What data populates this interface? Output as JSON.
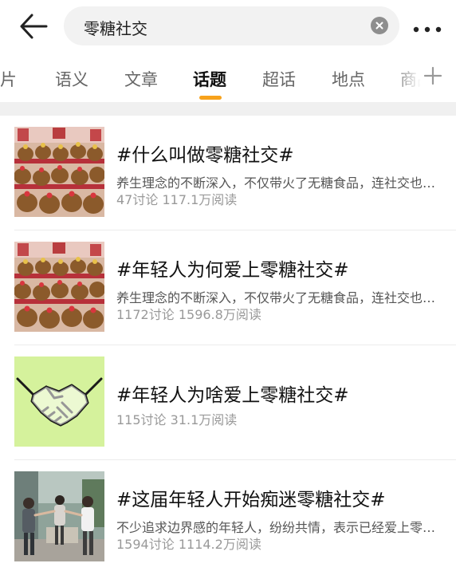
{
  "search": {
    "query": "零糖社交"
  },
  "tabs": [
    {
      "label": "图片"
    },
    {
      "label": "语义"
    },
    {
      "label": "文章"
    },
    {
      "label": "话题"
    },
    {
      "label": "超话"
    },
    {
      "label": "地点"
    },
    {
      "label": "商品"
    }
  ],
  "active_tab": "话题",
  "topics": [
    {
      "title": "#什么叫做零糖社交#",
      "desc": "养生理念的不断深入，不仅带火了无糖食品，连社交也开始讲究“零糖”了",
      "discussions": "47讨论",
      "reads": "117.1万阅读",
      "thumb_icon": "capybara-plush-photo"
    },
    {
      "title": "#年轻人为何爱上零糖社交#",
      "desc": "养生理念的不断深入，不仅带火了无糖食品，连社交也开始讲究“零糖”了",
      "discussions": "1172讨论",
      "reads": "1596.8万阅读",
      "thumb_icon": "capybara-plush-photo"
    },
    {
      "title": "#年轻人为啥爱上零糖社交#",
      "desc": "",
      "discussions": "115讨论",
      "reads": "31.1万阅读",
      "thumb_icon": "handshake-icon"
    },
    {
      "title": "#这届年轻人开始痴迷零糖社交#",
      "desc": "不少追求边界感的年轻人，纷纷共情，表示已经爱上零糖社交",
      "discussions": "1594讨论",
      "reads": "1114.2万阅读",
      "thumb_icon": "young-people-photo"
    }
  ],
  "colors": {
    "accent": "#f7a21b",
    "handshake_bg": "#d5f29c"
  }
}
